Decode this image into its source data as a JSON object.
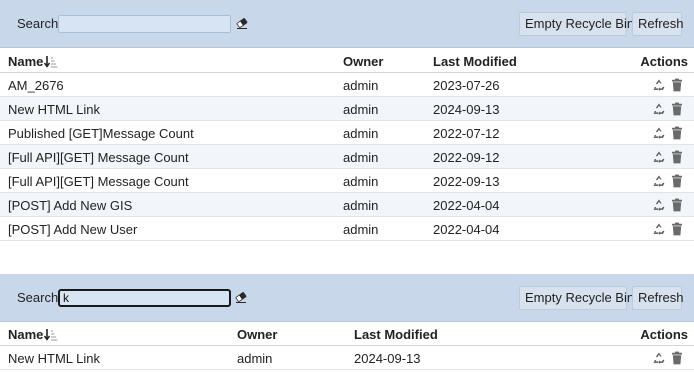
{
  "panels": [
    {
      "search": {
        "label": "Search",
        "value": "",
        "placeholder": ""
      },
      "buttons": {
        "empty": "Empty Recycle Bin",
        "refresh": "Refresh"
      },
      "columns": {
        "name": "Name",
        "owner": "Owner",
        "modified": "Last Modified",
        "actions": "Actions"
      },
      "rows": [
        {
          "name": "AM_2676",
          "owner": "admin",
          "modified": "2023-07-26"
        },
        {
          "name": "New HTML Link",
          "owner": "admin",
          "modified": "2024-09-13"
        },
        {
          "name": "Published [GET]Message Count",
          "owner": "admin",
          "modified": "2022-07-12"
        },
        {
          "name": "[Full API][GET] Message Count",
          "owner": "admin",
          "modified": "2022-09-12"
        },
        {
          "name": "[Full API][GET] Message Count",
          "owner": "admin",
          "modified": "2022-09-13"
        },
        {
          "name": "[POST] Add New GIS",
          "owner": "admin",
          "modified": "2022-04-04"
        },
        {
          "name": "[POST] Add New User",
          "owner": "admin",
          "modified": "2022-04-04"
        }
      ]
    },
    {
      "search": {
        "label": "Search",
        "value": "k",
        "placeholder": ""
      },
      "buttons": {
        "empty": "Empty Recycle Bin",
        "refresh": "Refresh"
      },
      "columns": {
        "name": "Name",
        "owner": "Owner",
        "modified": "Last Modified",
        "actions": "Actions"
      },
      "rows": [
        {
          "name": "New HTML Link",
          "owner": "admin",
          "modified": "2024-09-13"
        }
      ]
    }
  ],
  "icons": {
    "sort": "sort-descending-icon",
    "clear": "eraser-icon",
    "restore": "recycle-icon",
    "delete": "trash-icon"
  },
  "colors": {
    "toolbar": "#c8d8ea",
    "button": "#d7e2ee",
    "row_alt": "#f2f5f9",
    "icon": "#6a6a6a"
  }
}
